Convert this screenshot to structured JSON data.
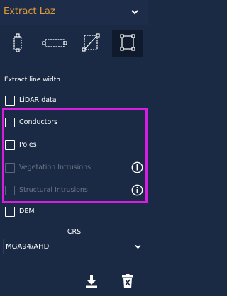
{
  "header": {
    "title": "Extract Laz",
    "title_color": "#e59a38",
    "collapse_icon": "chevron-down-icon"
  },
  "tools": [
    {
      "name": "vertical-corridor-icon",
      "selected": false
    },
    {
      "name": "horizontal-corridor-icon",
      "selected": false
    },
    {
      "name": "diagonal-corridor-icon",
      "selected": false
    },
    {
      "name": "box-select-icon",
      "selected": true
    }
  ],
  "section": {
    "label": "Extract line width"
  },
  "options": [
    {
      "label": "LiDAR data",
      "checked": false,
      "enabled": true
    },
    {
      "label": "Conductors",
      "checked": false,
      "enabled": true
    },
    {
      "label": "Poles",
      "checked": false,
      "enabled": true
    },
    {
      "label": "Vegetation Intrusions",
      "checked": false,
      "enabled": false,
      "info_icon": "info-icon"
    },
    {
      "label": "Structural Intrusions",
      "checked": false,
      "enabled": false,
      "info_icon": "info-icon"
    },
    {
      "label": "DEM",
      "checked": false,
      "enabled": true
    }
  ],
  "highlight_color": "#d51fe0",
  "crs": {
    "label": "CRS",
    "value": "MGA94/AHD"
  },
  "actions": {
    "download_icon": "download-icon",
    "delete_icon": "trash-icon"
  },
  "colors": {
    "background": "#1b2a44",
    "selected_tool_bg": "#0f1a2c"
  }
}
